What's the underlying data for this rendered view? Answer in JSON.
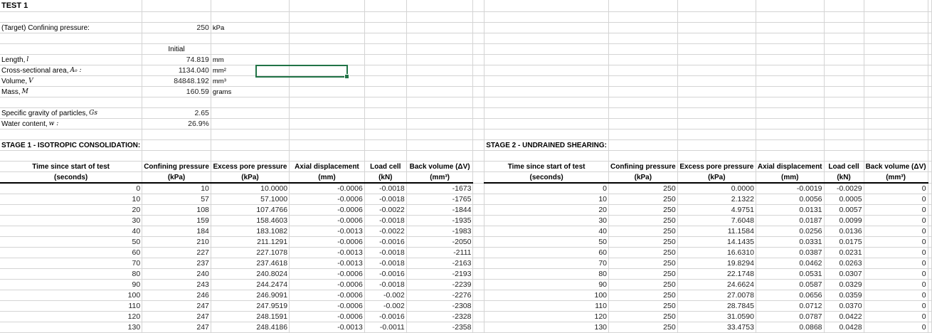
{
  "test_title": "TEST 1",
  "target_confining": {
    "label": "(Target) Confining pressure:",
    "value": "250",
    "unit": "kPa"
  },
  "initial_label": "Initial",
  "properties": [
    {
      "label": "Length, ",
      "symbol": "l",
      "value": "74.819",
      "unit": "mm"
    },
    {
      "label": "Cross-sectional area, ",
      "symbol": "A₀ :",
      "value": "1134.040",
      "unit": "mm²"
    },
    {
      "label": "Volume, ",
      "symbol": "V",
      "value": "84848.192",
      "unit": "mm³"
    },
    {
      "label": "Mass, ",
      "symbol": "M",
      "value": "160.59",
      "unit": "grams"
    }
  ],
  "soil": [
    {
      "label": "Specific gravity of particles, ",
      "symbol": "Gs",
      "value": "2.65"
    },
    {
      "label": "Water content, ",
      "symbol": "w :",
      "value": "26.9%"
    }
  ],
  "stage1": {
    "title": "STAGE 1 - ISOTROPIC CONSOLIDATION:",
    "headers": [
      "Time since start of test",
      "Confining pressure",
      "Excess pore pressure",
      "Axial displacement",
      "Load cell",
      "Back volume (ΔV)"
    ],
    "units": [
      "(seconds)",
      "(kPa)",
      "(kPa)",
      "(mm)",
      "(kN)",
      "(mm³)"
    ],
    "rows": [
      [
        "0",
        "10",
        "10.0000",
        "-0.0006",
        "-0.0018",
        "-1673"
      ],
      [
        "10",
        "57",
        "57.1000",
        "-0.0006",
        "-0.0018",
        "-1765"
      ],
      [
        "20",
        "108",
        "107.4766",
        "-0.0006",
        "-0.0022",
        "-1844"
      ],
      [
        "30",
        "159",
        "158.4603",
        "-0.0006",
        "-0.0018",
        "-1935"
      ],
      [
        "40",
        "184",
        "183.1082",
        "-0.0013",
        "-0.0022",
        "-1983"
      ],
      [
        "50",
        "210",
        "211.1291",
        "-0.0006",
        "-0.0016",
        "-2050"
      ],
      [
        "60",
        "227",
        "227.1078",
        "-0.0013",
        "-0.0018",
        "-2111"
      ],
      [
        "70",
        "237",
        "237.4618",
        "-0.0013",
        "-0.0018",
        "-2163"
      ],
      [
        "80",
        "240",
        "240.8024",
        "-0.0006",
        "-0.0016",
        "-2193"
      ],
      [
        "90",
        "243",
        "244.2474",
        "-0.0006",
        "-0.0018",
        "-2239"
      ],
      [
        "100",
        "246",
        "246.9091",
        "-0.0006",
        "-0.002",
        "-2276"
      ],
      [
        "110",
        "247",
        "247.9519",
        "-0.0006",
        "-0.002",
        "-2308"
      ],
      [
        "120",
        "247",
        "248.1591",
        "-0.0006",
        "-0.0016",
        "-2328"
      ],
      [
        "130",
        "247",
        "248.4186",
        "-0.0013",
        "-0.0011",
        "-2358"
      ]
    ]
  },
  "stage2": {
    "title": "STAGE 2 - UNDRAINED SHEARING:",
    "headers": [
      "Time since start of test",
      "Confining pressure",
      "Excess pore pressure",
      "Axial displacement",
      "Load cell",
      "Back volume (ΔV)"
    ],
    "units": [
      "(seconds)",
      "(kPa)",
      "(kPa)",
      "(mm)",
      "(kN)",
      "(mm³)"
    ],
    "rows": [
      [
        "0",
        "250",
        "0.0000",
        "-0.0019",
        "-0.0029",
        "0"
      ],
      [
        "10",
        "250",
        "2.1322",
        "0.0056",
        "0.0005",
        "0"
      ],
      [
        "20",
        "250",
        "4.9751",
        "0.0131",
        "0.0057",
        "0"
      ],
      [
        "30",
        "250",
        "7.6048",
        "0.0187",
        "0.0099",
        "0"
      ],
      [
        "40",
        "250",
        "11.1584",
        "0.0256",
        "0.0136",
        "0"
      ],
      [
        "50",
        "250",
        "14.1435",
        "0.0331",
        "0.0175",
        "0"
      ],
      [
        "60",
        "250",
        "16.6310",
        "0.0387",
        "0.0231",
        "0"
      ],
      [
        "70",
        "250",
        "19.8294",
        "0.0462",
        "0.0263",
        "0"
      ],
      [
        "80",
        "250",
        "22.1748",
        "0.0531",
        "0.0307",
        "0"
      ],
      [
        "90",
        "250",
        "24.6624",
        "0.0587",
        "0.0329",
        "0"
      ],
      [
        "100",
        "250",
        "27.0078",
        "0.0656",
        "0.0359",
        "0"
      ],
      [
        "110",
        "250",
        "28.7845",
        "0.0712",
        "0.0370",
        "0"
      ],
      [
        "120",
        "250",
        "31.0590",
        "0.0787",
        "0.0422",
        "0"
      ],
      [
        "130",
        "250",
        "33.4753",
        "0.0868",
        "0.0428",
        "0"
      ]
    ]
  },
  "colors": {
    "selection": "#217346",
    "gridline": "#d4d4d4"
  }
}
